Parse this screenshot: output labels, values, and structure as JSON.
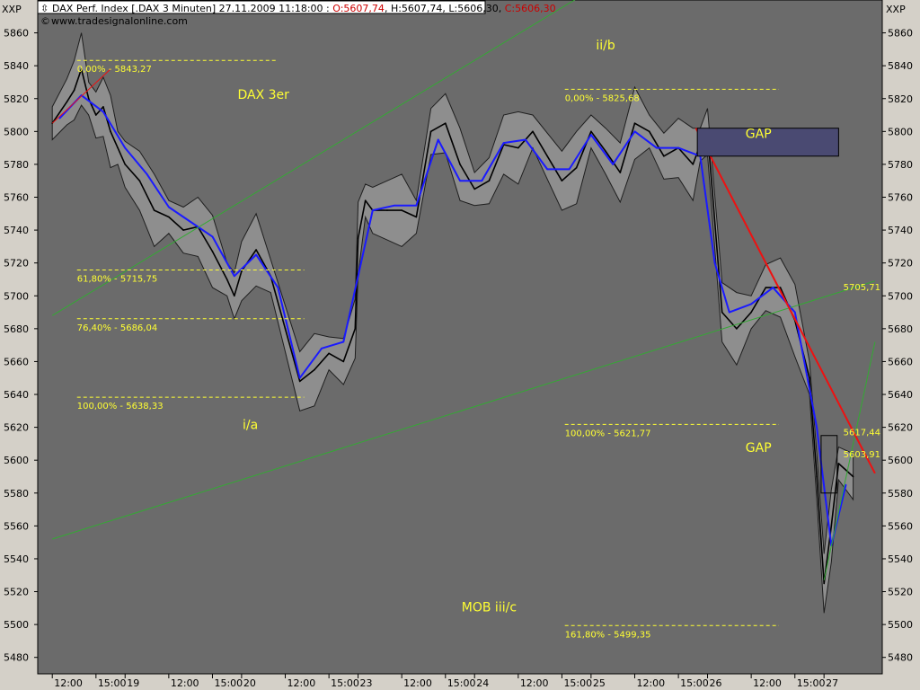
{
  "header": {
    "instrument": "DAX Perf. Index [.DAX  3 Minuten]",
    "datetime": "27.11.2009 11:18:00",
    "open": "O:5607,74",
    "high": "H:5607,74",
    "low": "L:5606,30",
    "close": "C:5606,30",
    "source": "www.tradesignalonline.com",
    "scale_label_left": "XXP",
    "scale_label_right": "XXP"
  },
  "colors": {
    "plot_bg": "#6b6b6b",
    "frame_bg": "#d4d0c8",
    "price": "#000000",
    "ma": "#1a1aff",
    "envelope": "#1e1e1e",
    "fib": "#ffff33",
    "trendline_green": "#33aa33",
    "trendline_red": "#ee1111",
    "gap_box": "#4a4a72",
    "close_box": "#cc0000"
  },
  "chart_data": {
    "type": "line",
    "title": "DAX Perf. Index [.DAX  3 Minuten]",
    "ylim": [
      5470,
      5880
    ],
    "y_ticks": [
      5860,
      5840,
      5820,
      5800,
      5780,
      5760,
      5740,
      5720,
      5700,
      5680,
      5660,
      5640,
      5620,
      5600,
      5580,
      5560,
      5540,
      5520,
      5500,
      5480
    ],
    "x_ticks": [
      "12:00",
      "15:00",
      "19",
      "12:00",
      "15:00",
      "20",
      "12:00",
      "15:00",
      "23",
      "12:00",
      "15:00",
      "24",
      "12:00",
      "15:00",
      "25",
      "12:00",
      "15:00",
      "26",
      "12:00",
      "15:00",
      "27"
    ],
    "x_tick_index": [
      0,
      3,
      5,
      8,
      11,
      13,
      16,
      19,
      21,
      24,
      27,
      29,
      32,
      35,
      37,
      40,
      43,
      45,
      48,
      51,
      53
    ],
    "x_range": [
      -1,
      57
    ],
    "series": [
      {
        "x": [
          0,
          1,
          1.5,
          2,
          2.5,
          3,
          3.5,
          4,
          4.5,
          5,
          6,
          7,
          8,
          9,
          10,
          11,
          12,
          12.5,
          13,
          14,
          15,
          16,
          17,
          18,
          19,
          20,
          20.8,
          21,
          21.5,
          22,
          23,
          24,
          25,
          26,
          27,
          28,
          29,
          30,
          31,
          32,
          33,
          34,
          35,
          36,
          37,
          38,
          39,
          40,
          41,
          42,
          43,
          44,
          44.5,
          45,
          46,
          47,
          48,
          49,
          50,
          51,
          52,
          52.5,
          53,
          53.5,
          54,
          55
        ],
        "values": [
          5805,
          5818,
          5825,
          5838,
          5820,
          5810,
          5815,
          5800,
          5790,
          5780,
          5770,
          5752,
          5748,
          5740,
          5742,
          5727,
          5710,
          5700,
          5715,
          5728,
          5712,
          5680,
          5648,
          5655,
          5665,
          5660,
          5680,
          5735,
          5758,
          5752,
          5752,
          5752,
          5748,
          5800,
          5805,
          5780,
          5765,
          5770,
          5792,
          5790,
          5800,
          5785,
          5770,
          5778,
          5800,
          5788,
          5775,
          5805,
          5800,
          5785,
          5790,
          5780,
          5792,
          5800,
          5690,
          5680,
          5690,
          5705,
          5705,
          5685,
          5650,
          5590,
          5525,
          5560,
          5598,
          5590
        ]
      },
      {
        "x": [
          0.5,
          2,
          3.5,
          5,
          6.5,
          8,
          9.5,
          11,
          12.5,
          14,
          15.5,
          17,
          18.5,
          20,
          21,
          22,
          23.5,
          25,
          26.5,
          28,
          29.5,
          31,
          32.5,
          34,
          35.5,
          37,
          38.5,
          40,
          41.5,
          43,
          44.5,
          45.5,
          46.5,
          48,
          49.5,
          51,
          52.5,
          53.5,
          54.5
        ],
        "values": [
          5808,
          5822,
          5812,
          5790,
          5774,
          5754,
          5745,
          5736,
          5712,
          5725,
          5705,
          5650,
          5668,
          5672,
          5712,
          5752,
          5755,
          5755,
          5795,
          5770,
          5770,
          5793,
          5795,
          5777,
          5777,
          5798,
          5780,
          5800,
          5790,
          5790,
          5785,
          5720,
          5690,
          5695,
          5705,
          5690,
          5620,
          5548,
          5585
        ]
      }
    ]
  },
  "trendlines": {
    "upper_green": {
      "from": [
        0,
        5688
      ],
      "to": [
        39.6,
        5900
      ]
    },
    "lower_green": {
      "from": [
        0,
        5552
      ],
      "to": [
        56.5,
        5709
      ]
    },
    "short_green": {
      "from": [
        53,
        5527
      ],
      "to": [
        56.5,
        5672
      ]
    },
    "red_main": {
      "from": [
        44.2,
        5802
      ],
      "to": [
        56.5,
        5592
      ]
    },
    "red_early": {
      "from": [
        0,
        5805
      ],
      "to": [
        4,
        5838
      ]
    }
  },
  "zones": [
    {
      "label": "GAP",
      "x0": 44.3,
      "x1": 54.0,
      "low": 5785,
      "high": 5802,
      "filled": true
    },
    {
      "label": "",
      "x0": 52.8,
      "x1": 53.9,
      "low": 5580,
      "high": 5615,
      "filled": false
    }
  ],
  "fib_levels": [
    {
      "label": "0,00% - 5843,27",
      "value": 5843.27,
      "x0": 1.7,
      "x1": 15.5
    },
    {
      "label": "61,80% - 5715,75",
      "value": 5715.75,
      "x0": 1.7,
      "x1": 17.3
    },
    {
      "label": "76,40% - 5686,04",
      "value": 5686.04,
      "x0": 1.7,
      "x1": 17.3
    },
    {
      "label": "100,00% - 5638,33",
      "value": 5638.33,
      "x0": 1.7,
      "x1": 17.3
    },
    {
      "label": "0,00% - 5825,68",
      "value": 5825.68,
      "x0": 35.2,
      "x1": 49.9
    },
    {
      "label": "100,00% - 5621,77",
      "value": 5621.77,
      "x0": 35.2,
      "x1": 49.9
    },
    {
      "label": "161,80% - 5499,35",
      "value": 5499.35,
      "x0": 35.2,
      "x1": 49.9
    }
  ],
  "annotations": [
    {
      "text": "DAX 3er",
      "x": 14.5,
      "y": 5820
    },
    {
      "text": "ii/b",
      "x": 38.0,
      "y": 5850
    },
    {
      "text": "i/a",
      "x": 13.6,
      "y": 5619
    },
    {
      "text": "MOB iii/c",
      "x": 30.0,
      "y": 5508
    },
    {
      "text": "GAP",
      "x": 48.5,
      "y": 5796
    },
    {
      "text": "GAP",
      "x": 48.5,
      "y": 5605
    }
  ],
  "value_labels": [
    {
      "text": "5705,71",
      "y": 5705.71,
      "color": "#33cc33"
    },
    {
      "text": "5617,44",
      "y": 5617.44,
      "color": "#ee2222"
    },
    {
      "text": "5603,91",
      "y": 5603.91,
      "color": "#33cc33"
    }
  ]
}
